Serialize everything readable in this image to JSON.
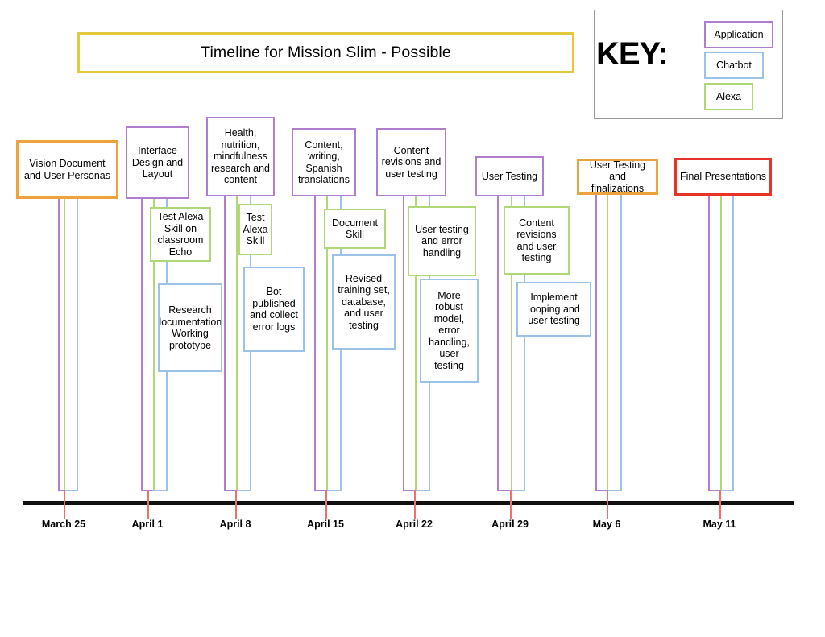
{
  "title": {
    "text": "Timeline for Mission Slim - Possible"
  },
  "key": {
    "label": "KEY:",
    "items": [
      {
        "label": "Application",
        "color": "#b07ecf"
      },
      {
        "label": "Chatbot",
        "color": "#9cc3e5"
      },
      {
        "label": "Alexa",
        "color": "#b0d877"
      }
    ]
  },
  "axis": {
    "dates": [
      "March 25",
      "April 1",
      "April 8",
      "April 15",
      "April 22",
      "April 29",
      "May 6",
      "May 11"
    ]
  },
  "milestones": [
    {
      "date": "March 25",
      "header": {
        "text": "Vision Document and User Personas",
        "category": "document",
        "color": "#eda33c"
      },
      "tasks": []
    },
    {
      "date": "April 1",
      "header": {
        "text": "Interface Design and Layout",
        "category": "application",
        "color": "#b07ecf"
      },
      "tasks": [
        {
          "text": "Test Alexa Skill on classroom Echo",
          "category": "alexa",
          "color": "#b0d877"
        },
        {
          "text": "Research documentation/ Working prototype",
          "category": "chatbot",
          "color": "#9cc3e5"
        }
      ]
    },
    {
      "date": "April 8",
      "header": {
        "text": "Health, nutrition, mindfulness research and content",
        "category": "application",
        "color": "#b07ecf"
      },
      "tasks": [
        {
          "text": "Test Alexa Skill",
          "category": "alexa",
          "color": "#b0d877"
        },
        {
          "text": "Bot published and collect error logs",
          "category": "chatbot",
          "color": "#9cc3e5"
        }
      ]
    },
    {
      "date": "April 15",
      "header": {
        "text": "Content, writing, Spanish translations",
        "category": "application",
        "color": "#b07ecf"
      },
      "tasks": [
        {
          "text": "Document Skill",
          "category": "alexa",
          "color": "#b0d877"
        },
        {
          "text": "Revised training set, database, and user testing",
          "category": "chatbot",
          "color": "#9cc3e5"
        }
      ]
    },
    {
      "date": "April 22",
      "header": {
        "text": "Content revisions and user testing",
        "category": "application",
        "color": "#b07ecf"
      },
      "tasks": [
        {
          "text": "User testing and error handling",
          "category": "alexa",
          "color": "#b0d877"
        },
        {
          "text": "More robust model, error handling, user testing",
          "category": "chatbot",
          "color": "#9cc3e5"
        }
      ]
    },
    {
      "date": "April 29",
      "header": {
        "text": "User Testing",
        "category": "application",
        "color": "#b07ecf"
      },
      "tasks": [
        {
          "text": "Content revisions and user testing",
          "category": "alexa",
          "color": "#b0d877"
        },
        {
          "text": "Implement looping and user testing",
          "category": "chatbot",
          "color": "#9cc3e5"
        }
      ]
    },
    {
      "date": "May 6",
      "header": {
        "text": "User Testing and finalizations",
        "category": "document",
        "color": "#eda33c"
      },
      "tasks": []
    },
    {
      "date": "May 11",
      "header": {
        "text": "Final Presentations",
        "category": "final",
        "color": "#e8332a"
      },
      "tasks": []
    }
  ]
}
